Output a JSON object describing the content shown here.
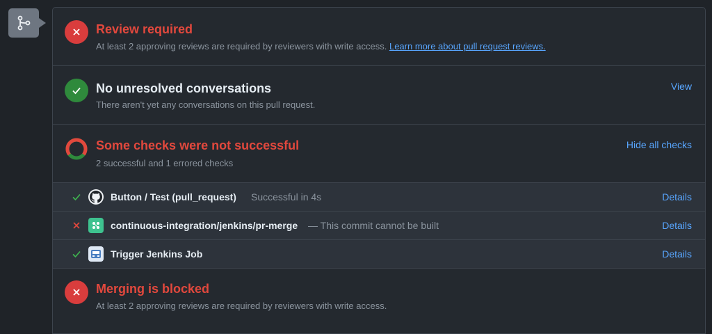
{
  "merge_box": {
    "sections": {
      "review": {
        "title": "Review required",
        "subtitle": "At least 2 approving reviews are required by reviewers with write access.",
        "link": "Learn more about pull request reviews."
      },
      "conversations": {
        "title": "No unresolved conversations",
        "subtitle": "There aren't yet any conversations on this pull request.",
        "action": "View"
      },
      "checks": {
        "title": "Some checks were not successful",
        "subtitle": "2 successful and 1 errored checks",
        "action": "Hide all checks",
        "rows": [
          {
            "name": "Button / Test (pull_request)",
            "description": "Successful in 4s",
            "status": "success",
            "details": "Details"
          },
          {
            "name": "continuous-integration/jenkins/pr-merge",
            "description": "— This commit cannot be built",
            "status": "error",
            "details": "Details"
          },
          {
            "name": "Trigger Jenkins Job",
            "description": "",
            "status": "success",
            "details": "Details"
          }
        ]
      },
      "merging": {
        "title": "Merging is blocked",
        "subtitle": "At least 2 approving reviews are required by reviewers with write access."
      }
    }
  },
  "colors": {
    "error": "#e2483d",
    "success": "#2f8a3c",
    "link": "#58a6ff"
  }
}
